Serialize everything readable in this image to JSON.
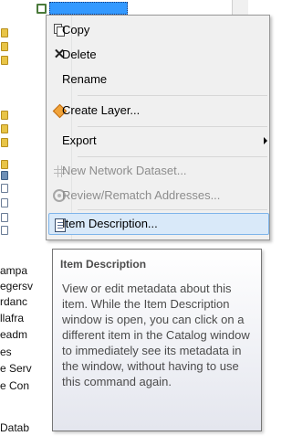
{
  "catalog_tree": {
    "selected_item_label": "",
    "items": [
      {
        "label": "ampa"
      },
      {
        "label": "egersv"
      },
      {
        "label": "rdanc"
      },
      {
        "label": "llafra"
      },
      {
        "label": "eadm"
      },
      {
        "label": "es"
      },
      {
        "label": "e Serv"
      },
      {
        "label": "e Con"
      },
      {
        "label": "Datab"
      }
    ]
  },
  "context_menu": {
    "items": [
      {
        "label": "Copy",
        "icon": "copy-icon",
        "enabled": true
      },
      {
        "label": "Delete",
        "icon": "delete-icon",
        "enabled": true
      },
      {
        "label": "Rename",
        "icon": "",
        "enabled": true
      },
      {
        "label": "Create Layer...",
        "icon": "create-layer-icon",
        "enabled": true
      },
      {
        "label": "Export",
        "icon": "",
        "enabled": true,
        "has_submenu": true
      },
      {
        "label": "New Network Dataset...",
        "icon": "network-dataset-icon",
        "enabled": false
      },
      {
        "label": "Review/Rematch Addresses...",
        "icon": "rematch-icon",
        "enabled": false
      },
      {
        "label": "Item Description...",
        "icon": "item-description-icon",
        "enabled": true,
        "highlighted": true
      }
    ]
  },
  "tooltip": {
    "title": "Item Description",
    "body": "View or edit metadata about this item. While the Item Description window is open, you can click on a different item in the Catalog window to immediately see its metadata in the window, without having to use this command again."
  },
  "colors": {
    "menu_background": "#f0f0f0",
    "highlight_fill": "#d9e9f9",
    "highlight_border": "#7eb4ea",
    "selection_blue": "#3399ff",
    "disabled_text": "#8d8d8d"
  }
}
